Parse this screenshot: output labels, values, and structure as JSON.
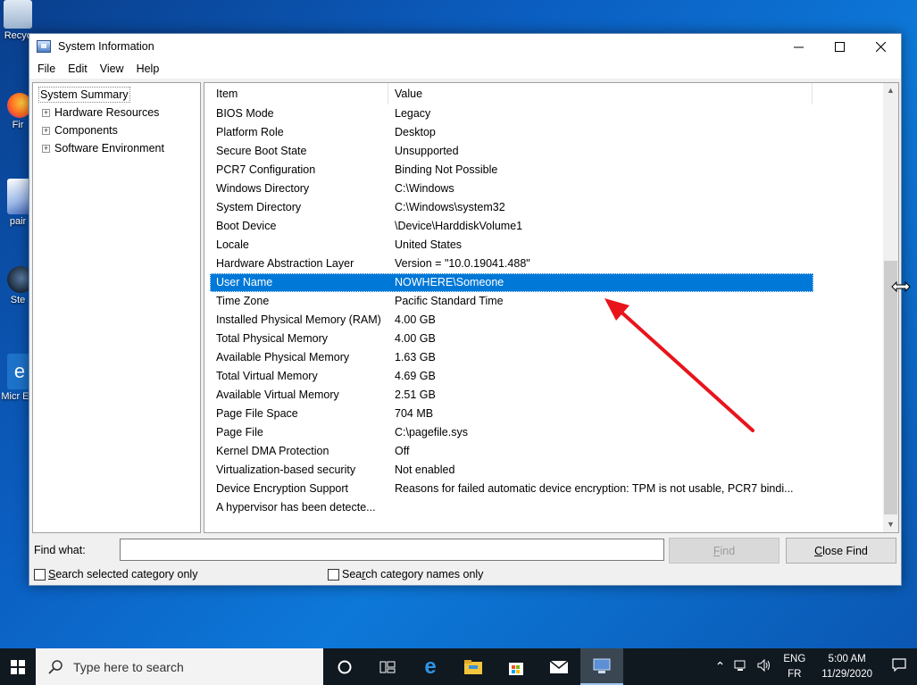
{
  "desktop": {
    "icons": [
      {
        "name": "recycle-bin",
        "label": "Recyc"
      },
      {
        "name": "firefox",
        "label": "Fir"
      },
      {
        "name": "paint",
        "label": "pair"
      },
      {
        "name": "steam",
        "label": "Ste"
      },
      {
        "name": "edge",
        "label": "Micr Ed"
      }
    ]
  },
  "window": {
    "title": "System Information",
    "controls": {
      "minimize": "—",
      "maximize": "☐",
      "close": "✕"
    }
  },
  "menu": {
    "file": "File",
    "edit": "Edit",
    "view": "View",
    "help": "Help"
  },
  "tree": {
    "root": "System Summary",
    "children": [
      "Hardware Resources",
      "Components",
      "Software Environment"
    ],
    "expander": "+"
  },
  "list": {
    "headers": {
      "item": "Item",
      "value": "Value"
    },
    "rows": [
      {
        "item": "BIOS Mode",
        "value": "Legacy"
      },
      {
        "item": "Platform Role",
        "value": "Desktop"
      },
      {
        "item": "Secure Boot State",
        "value": "Unsupported"
      },
      {
        "item": "PCR7 Configuration",
        "value": "Binding Not Possible"
      },
      {
        "item": "Windows Directory",
        "value": "C:\\Windows"
      },
      {
        "item": "System Directory",
        "value": "C:\\Windows\\system32"
      },
      {
        "item": "Boot Device",
        "value": "\\Device\\HarddiskVolume1"
      },
      {
        "item": "Locale",
        "value": "United States"
      },
      {
        "item": "Hardware Abstraction Layer",
        "value": "Version = \"10.0.19041.488\""
      },
      {
        "item": "User Name",
        "value": "NOWHERE\\Someone",
        "selected": true
      },
      {
        "item": "Time Zone",
        "value": "Pacific Standard Time"
      },
      {
        "item": "Installed Physical Memory (RAM)",
        "value": "4.00 GB"
      },
      {
        "item": "Total Physical Memory",
        "value": "4.00 GB"
      },
      {
        "item": "Available Physical Memory",
        "value": "1.63 GB"
      },
      {
        "item": "Total Virtual Memory",
        "value": "4.69 GB"
      },
      {
        "item": "Available Virtual Memory",
        "value": "2.51 GB"
      },
      {
        "item": "Page File Space",
        "value": "704 MB"
      },
      {
        "item": "Page File",
        "value": "C:\\pagefile.sys"
      },
      {
        "item": "Kernel DMA Protection",
        "value": "Off"
      },
      {
        "item": "Virtualization-based security",
        "value": "Not enabled"
      },
      {
        "item": "Device Encryption Support",
        "value": "Reasons for failed automatic device encryption: TPM is not usable, PCR7 bindi..."
      },
      {
        "item": "A hypervisor has been detecte...",
        "value": ""
      }
    ],
    "scroll": {
      "up": "▲",
      "down": "▼"
    }
  },
  "findbar": {
    "label": "Find what:",
    "input_value": "",
    "find_button": {
      "pre": "",
      "ul": "F",
      "post": "ind"
    },
    "close_find_button": {
      "pre": "",
      "ul": "C",
      "post": "lose Find"
    },
    "check_selected": {
      "ul": "S",
      "rest": "earch selected category only"
    },
    "check_names": {
      "pre": "Sea",
      "ul": "r",
      "rest": "ch category names only"
    }
  },
  "taskbar": {
    "search_placeholder": "Type here to search",
    "lang_top": "ENG",
    "lang_bottom": "FR",
    "time": "5:00 AM",
    "date": "11/29/2020"
  },
  "colors": {
    "selection": "#0078d7",
    "annotation_arrow": "#e8141c"
  }
}
